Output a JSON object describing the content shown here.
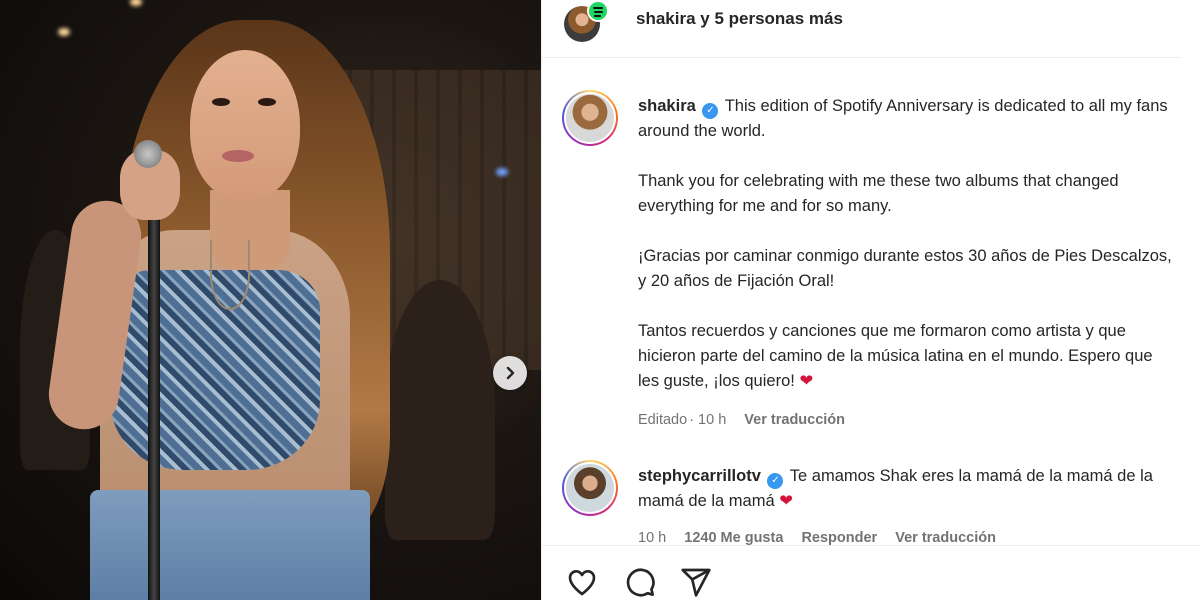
{
  "post": {
    "header": {
      "title": "shakira y 5 personas más"
    },
    "caption": {
      "username": "shakira",
      "text": "This edition of Spotify Anniversary is dedicated to all my fans around the world.\n\nThank you for celebrating with me these two albums that changed everything for me and for so many.\n\n¡Gracias por caminar conmigo durante estos 30 años de Pies Descalzos, y 20 años de Fijación Oral!\n\nTantos recuerdos y canciones que me formaron como artista y que hicieron parte del camino de la música latina en el mundo. Espero que les guste, ¡los quiero!",
      "emoji": "❤",
      "edited_label": "Editado",
      "time": "10 h",
      "translate_label": "Ver traducción"
    },
    "comments": [
      {
        "username": "stephycarrillotv",
        "text": "Te amamos Shak eres la mamá de la mamá de la mamá de la mamá",
        "emoji": "❤",
        "time": "10 h",
        "likes": "1240 Me gusta",
        "reply_label": "Responder",
        "translate_label": "Ver traducción"
      }
    ]
  },
  "icons": {
    "next": "chevron-right-icon",
    "like": "heart-icon",
    "comment": "comment-icon",
    "share": "send-icon",
    "verified": "verified-badge-icon"
  },
  "colors": {
    "verified": "#3897f0",
    "heart": "#d3133a",
    "spotify": "#1ed760"
  }
}
